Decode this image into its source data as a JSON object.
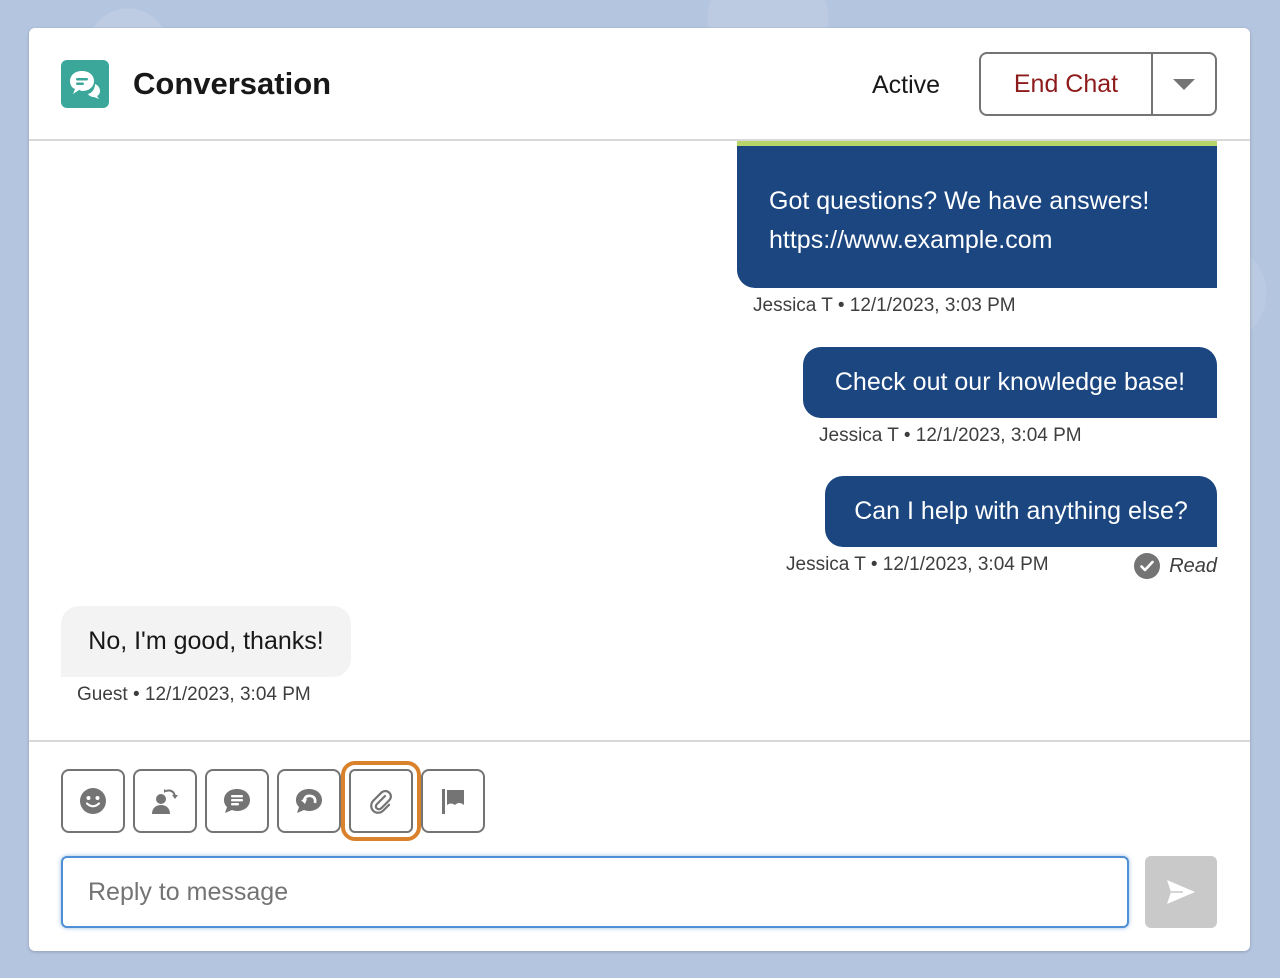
{
  "header": {
    "title": "Conversation",
    "status": "Active",
    "end_chat_label": "End Chat",
    "icon": "chat-conversation-icon",
    "icon_color": "#3ba79a"
  },
  "messages": [
    {
      "direction": "outbound",
      "lines": [
        "Got questions? We have answers!",
        "https://www.example.com"
      ],
      "meta": "Jessica T • 12/1/2023, 3:03 PM",
      "accent_color": "#b8d56a"
    },
    {
      "direction": "outbound",
      "text": "Check out our knowledge base!",
      "meta": "Jessica T • 12/1/2023, 3:04 PM"
    },
    {
      "direction": "outbound",
      "text": "Can I help with anything else?",
      "meta": "Jessica T • 12/1/2023, 3:04 PM",
      "receipt": "Read"
    },
    {
      "direction": "inbound",
      "text": "No, I'm good, thanks!",
      "meta": "Guest • 12/1/2023, 3:04 PM"
    }
  ],
  "toolbar": {
    "tools": [
      {
        "name": "emoji",
        "icon": "emoji-smile-icon"
      },
      {
        "name": "transfer",
        "icon": "transfer-user-icon"
      },
      {
        "name": "quick-text",
        "icon": "quick-text-icon"
      },
      {
        "name": "knowledge",
        "icon": "knowledge-reply-icon"
      },
      {
        "name": "attach",
        "icon": "paperclip-icon",
        "highlighted": true
      },
      {
        "name": "flag",
        "icon": "flag-icon"
      }
    ],
    "highlight_color": "#d9822b"
  },
  "composer": {
    "placeholder": "Reply to message",
    "value": "",
    "send_icon": "send-icon"
  },
  "colors": {
    "outbound_bubble": "#1b4680",
    "inbound_bubble": "#f3f3f3",
    "end_chat_text": "#8e1b1b"
  }
}
